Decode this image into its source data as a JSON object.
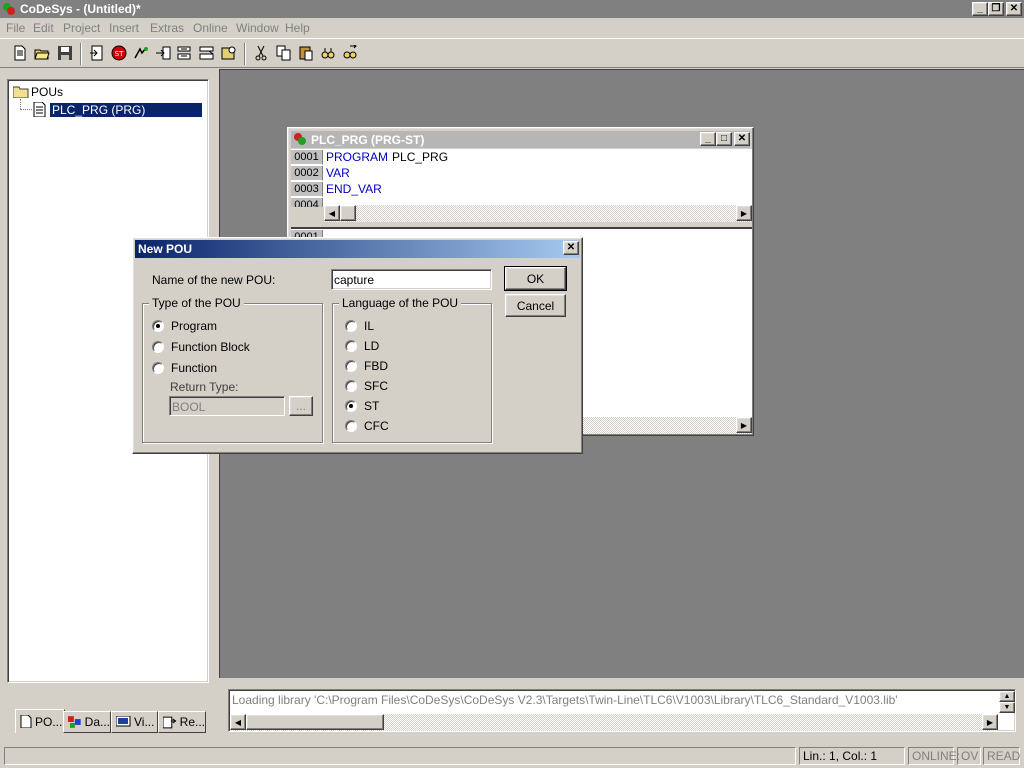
{
  "app": {
    "title": "CoDeSys - (Untitled)*"
  },
  "menu": [
    "File",
    "Edit",
    "Project",
    "Insert",
    "Extras",
    "Online",
    "Window",
    "Help"
  ],
  "toolbar": {
    "icons": [
      "new-icon",
      "open-icon",
      "save-icon",
      "login-icon",
      "stop-icon",
      "run-icon",
      "step-over-icon",
      "step-in-icon",
      "single-cycle-icon",
      "breakpoint-icon",
      "cut-icon",
      "copy-icon",
      "paste-icon",
      "find-icon",
      "find-next-icon",
      "replace-icon"
    ]
  },
  "object_tree": {
    "root": "POUs",
    "items": [
      "PLC_PRG (PRG)"
    ],
    "selected_index": 0
  },
  "left_tabs": [
    "PO...",
    "Da...",
    "Vi...",
    "Re..."
  ],
  "editor": {
    "title": "PLC_PRG (PRG-ST)",
    "decl_lines": [
      {
        "num": "0001",
        "kw": "PROGRAM",
        "id": "PLC_PRG"
      },
      {
        "num": "0002",
        "kw": "VAR",
        "id": ""
      },
      {
        "num": "0003",
        "kw": "END_VAR",
        "id": ""
      },
      {
        "num": "0004",
        "kw": "",
        "id": ""
      }
    ],
    "body_lines": [
      {
        "num": "0001"
      }
    ]
  },
  "dialog": {
    "title": "New POU",
    "name_label": "Name of the new POU:",
    "name_value": "capture",
    "ok_label": "OK",
    "cancel_label": "Cancel",
    "type_group": {
      "title": "Type of the POU",
      "options": [
        "Program",
        "Function Block",
        "Function"
      ],
      "selected": "Program",
      "return_type_label": "Return Type:",
      "return_type_value": "BOOL",
      "browse_label": "..."
    },
    "lang_group": {
      "title": "Language of the POU",
      "options": [
        "IL",
        "LD",
        "FBD",
        "SFC",
        "ST",
        "CFC"
      ],
      "selected": "ST"
    }
  },
  "messages": {
    "text": "Loading library 'C:\\Program Files\\CoDeSys\\CoDeSys V2.3\\Targets\\Twin-Line\\TLC6\\V1003\\Library\\TLC6_Standard_V1003.lib'"
  },
  "status": {
    "position": "Lin.: 1, Col.: 1",
    "online": "ONLINE:",
    "sim": "OV",
    "read": "READ"
  }
}
